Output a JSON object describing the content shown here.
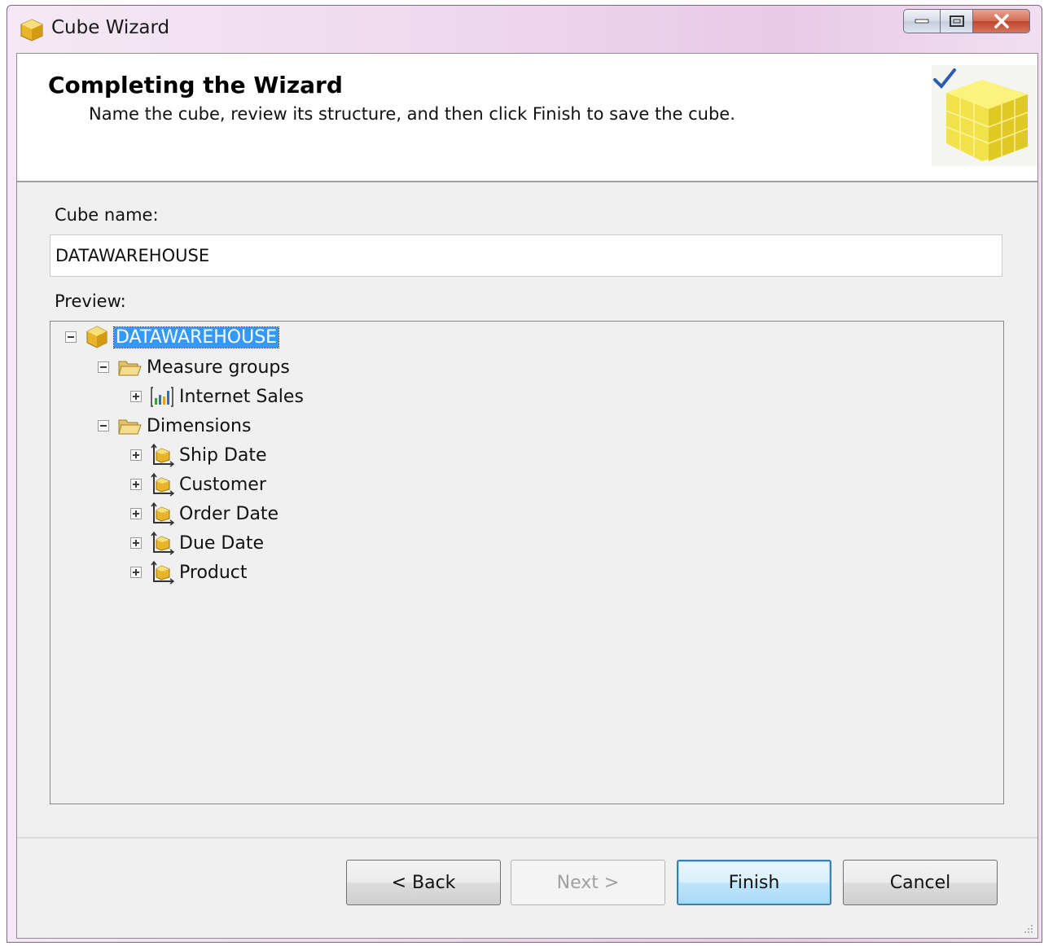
{
  "window": {
    "title": "Cube Wizard",
    "icon": "cube-icon"
  },
  "header": {
    "title": "Completing the Wizard",
    "subtitle": "Name the cube, review its structure, and then click Finish to save the cube.",
    "image": "wizard-cube-check-icon"
  },
  "form": {
    "cube_name_label": "Cube name:",
    "cube_name_value": "DATAWAREHOUSE",
    "preview_label": "Preview:"
  },
  "tree": {
    "root": "DATAWAREHOUSE",
    "measure_groups_label": "Measure groups",
    "measure_groups": [
      "Internet Sales"
    ],
    "dimensions_label": "Dimensions",
    "dimensions": [
      "Ship Date",
      "Customer",
      "Order Date",
      "Due Date",
      "Product"
    ]
  },
  "buttons": {
    "back": "< Back",
    "next": "Next >",
    "finish": "Finish",
    "cancel": "Cancel"
  }
}
